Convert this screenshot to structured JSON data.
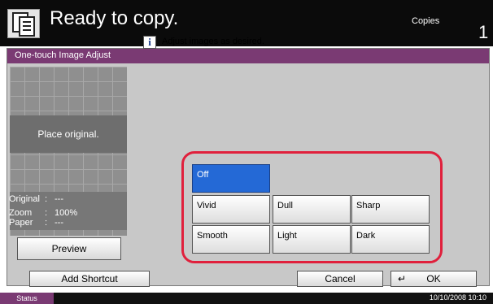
{
  "header": {
    "title": "Ready to copy.",
    "copies_label": "Copies",
    "copies_value": "1"
  },
  "panel": {
    "title": "One-touch Image Adjust"
  },
  "preview": {
    "placeholder": "Place original.",
    "info": [
      {
        "key": "Original",
        "value": "---"
      },
      {
        "key": "Zoom",
        "value": "100%"
      },
      {
        "key": "Paper",
        "value": "---"
      }
    ],
    "button": "Preview"
  },
  "message": {
    "text": "Adjust images as desired."
  },
  "options": {
    "off": "Off",
    "row1": [
      "Vivid",
      "Dull",
      "Sharp"
    ],
    "row2": [
      "Smooth",
      "Light",
      "Dark"
    ],
    "selected": "Off"
  },
  "footer": {
    "add_shortcut": "Add Shortcut",
    "cancel": "Cancel",
    "ok": "OK"
  },
  "status": {
    "label": "Status",
    "datetime": "10/10/2008   10:10"
  },
  "colors": {
    "accent": "#7a3a73",
    "highlight": "#e0203c",
    "selected": "#2469d6"
  }
}
